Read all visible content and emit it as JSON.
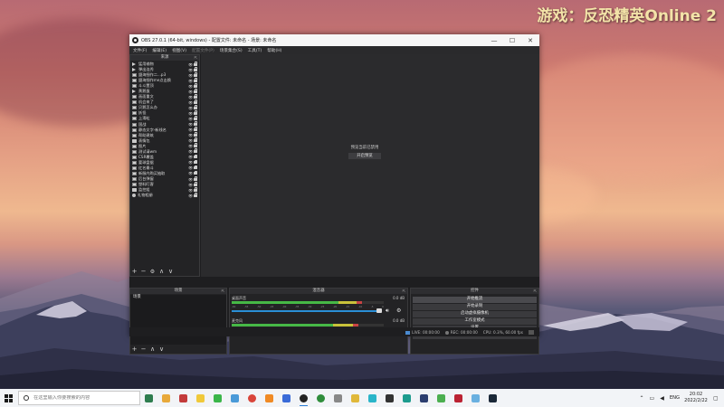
{
  "overlay": {
    "game_title": "游戏：反恐精英Online 2"
  },
  "obs": {
    "window_title": "OBS 27.0.1 (64-bit, windows) - 配置文件: 未命名 - 场景: 未命名",
    "window_buttons": {
      "minimize": "—",
      "maximize": "☐",
      "close": "✕"
    },
    "menu": [
      "文件(F)",
      "编辑(E)",
      "视图(V)",
      "配置文件(P)",
      "场景集合(S)",
      "工具(T)",
      "帮助(H)"
    ],
    "sources_panel": {
      "title": "来源",
      "items": [
        {
          "name": "猛用输物",
          "icon": "arrow"
        },
        {
          "name": "弹出连秀",
          "icon": "arrow"
        },
        {
          "name": "盟海细作二...p3",
          "icon": "img"
        },
        {
          "name": "盟海细作me点击换",
          "icon": "img"
        },
        {
          "name": "斗斗置顶",
          "icon": "img"
        },
        {
          "name": "黄鹅蛋",
          "icon": "arrow"
        },
        {
          "name": "画面重文",
          "icon": "img"
        },
        {
          "name": "机会来了",
          "icon": "img"
        },
        {
          "name": "贝鹅怎么办",
          "icon": "img"
        },
        {
          "name": "妖怪",
          "icon": "img"
        },
        {
          "name": "上滑粒",
          "icon": "img"
        },
        {
          "name": "国战",
          "icon": "img"
        },
        {
          "name": "静态文字-新线名",
          "icon": "img"
        },
        {
          "name": "帮助建筑",
          "icon": "img"
        },
        {
          "name": "表情包",
          "icon": "folder"
        },
        {
          "name": "图片",
          "icon": "img"
        },
        {
          "name": "测试请wm",
          "icon": "img"
        },
        {
          "name": "CSR覆盖",
          "icon": "img"
        },
        {
          "name": "要球盘据",
          "icon": "img"
        },
        {
          "name": "红名最斗",
          "icon": "img"
        },
        {
          "name": "新服内购买抽取",
          "icon": "img"
        },
        {
          "name": "后台弹窗",
          "icon": "img"
        },
        {
          "name": "塑料盯客",
          "icon": "img"
        },
        {
          "name": "监控组",
          "icon": "folder"
        },
        {
          "name": "礼物相册",
          "icon": "globe"
        }
      ],
      "toolbar": [
        "+",
        "−",
        "⚙",
        "∧",
        "∨"
      ]
    },
    "preview": {
      "message": "预览当前已禁用",
      "start_button": "开启预览"
    },
    "scenes_panel": {
      "title": "场景",
      "items": [
        "场景"
      ],
      "toolbar": [
        "+",
        "−",
        "∧",
        "∨"
      ]
    },
    "mixer_panel": {
      "title": "混音器",
      "channels": [
        {
          "name": "桌面声音",
          "db": "0.0 dB",
          "level": 0.82
        },
        {
          "name": "麦克风",
          "db": "0.0 dB",
          "level": 0.78
        }
      ],
      "ticks": [
        "-60",
        "-55",
        "-50",
        "-45",
        "-40",
        "-35",
        "-30",
        "-25",
        "-20",
        "-15",
        "-10",
        "-5",
        "0"
      ]
    },
    "controls_panel": {
      "title": "控件",
      "buttons": [
        "开始推流",
        "开始录制",
        "启动虚拟摄像机",
        "工作室模式",
        "设置",
        "退出"
      ]
    },
    "status": {
      "live": "LIVE: 00:00:00",
      "rec": "REC: 00:00:00",
      "cpu": "CPU: 0.3%, 60.00 fps"
    }
  },
  "taskbar": {
    "search_placeholder": "在这里输入你要搜索的内容",
    "tray": {
      "language": "ENG",
      "time": "20:02",
      "date": "2022/2/22"
    }
  },
  "colors": {
    "accent": "#2b7fd6",
    "meter_green": "#46b846",
    "fader_blue": "#2a8fd6"
  }
}
